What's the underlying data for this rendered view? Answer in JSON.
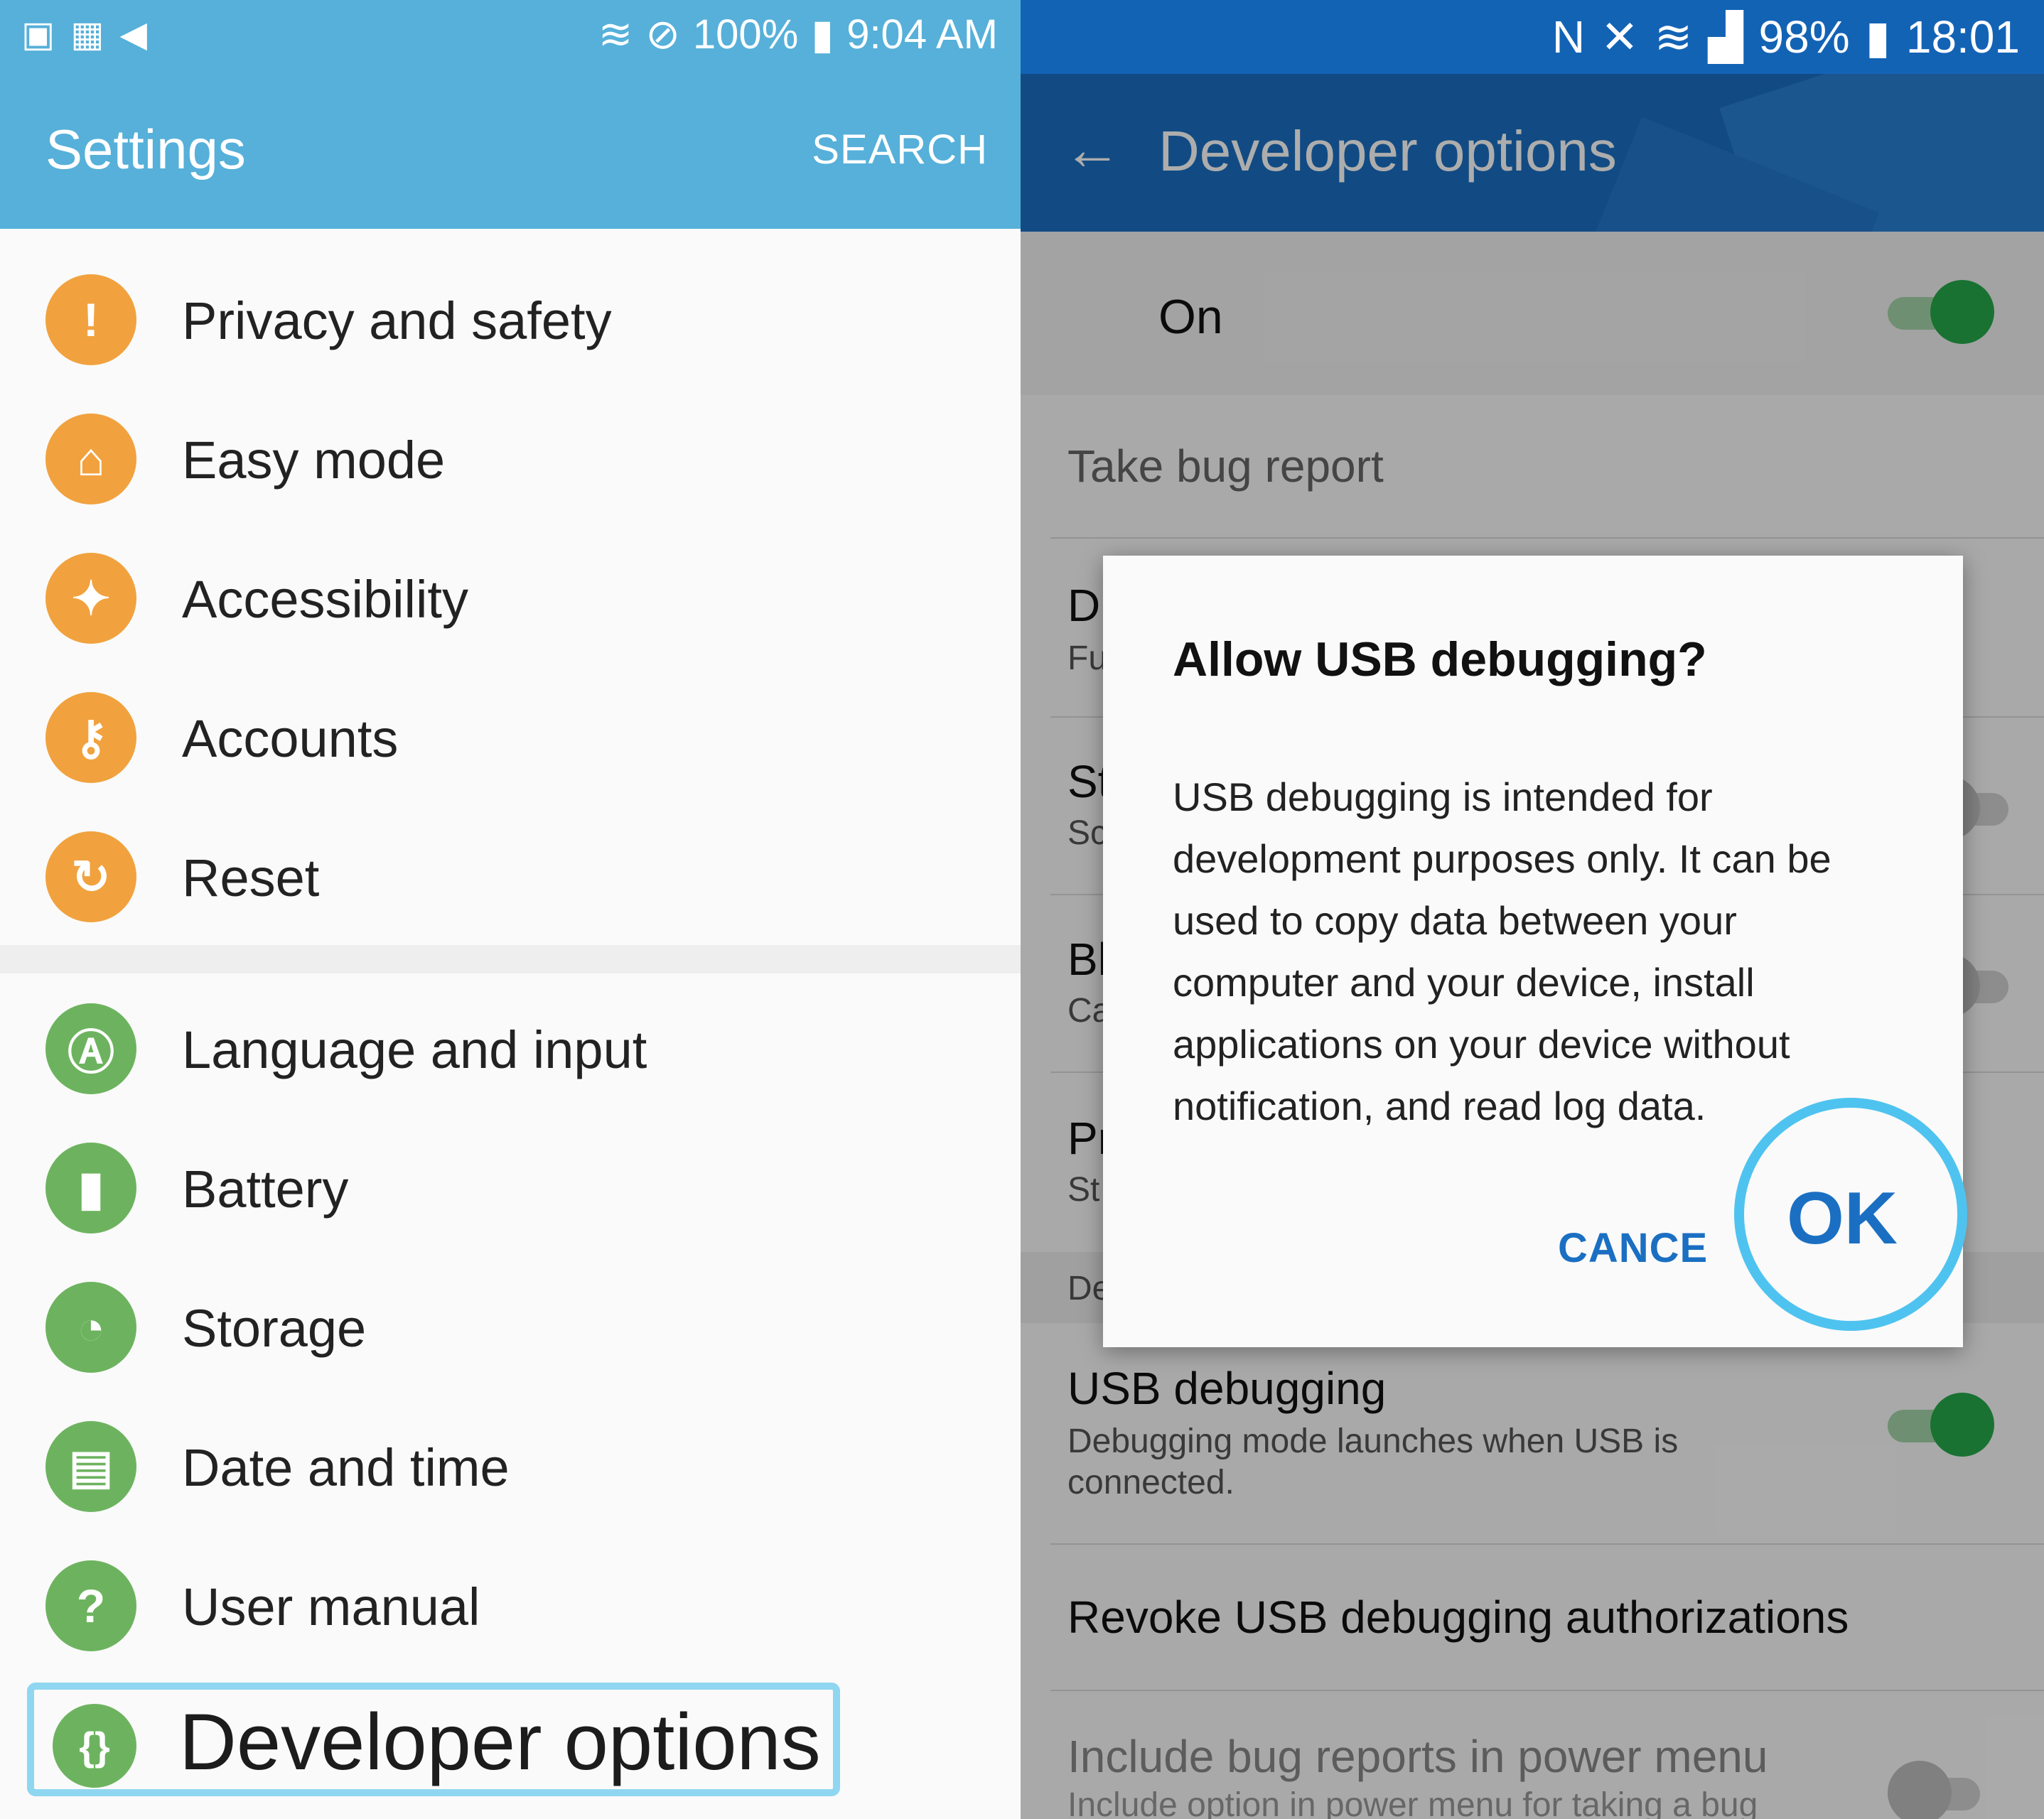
{
  "left": {
    "status": {
      "icons_left": [
        "image-icon",
        "calendar-icon",
        "telegram-icon"
      ],
      "battery": "100%",
      "time": "9:04 AM"
    },
    "title": "Settings",
    "search": "SEARCH",
    "items_group1": [
      {
        "label": "Privacy and safety",
        "icon": "privacy-icon",
        "color": "#f1a23e"
      },
      {
        "label": "Easy mode",
        "icon": "easy-mode-icon",
        "color": "#f1a23e"
      },
      {
        "label": "Accessibility",
        "icon": "accessibility-icon",
        "color": "#f1a23e"
      },
      {
        "label": "Accounts",
        "icon": "accounts-key-icon",
        "color": "#f1a23e"
      },
      {
        "label": "Reset",
        "icon": "reset-icon",
        "color": "#f1a23e"
      }
    ],
    "items_group2": [
      {
        "label": "Language and input",
        "icon": "language-icon",
        "color": "#6db35f"
      },
      {
        "label": "Battery",
        "icon": "battery-icon",
        "color": "#6db35f"
      },
      {
        "label": "Storage",
        "icon": "storage-icon",
        "color": "#6db35f"
      },
      {
        "label": "Date and time",
        "icon": "date-time-icon",
        "color": "#6db35f"
      },
      {
        "label": "User manual",
        "icon": "user-manual-icon",
        "color": "#6db35f"
      }
    ],
    "developer": {
      "label": "Developer options",
      "icon": "developer-braces-icon"
    }
  },
  "right": {
    "status": {
      "battery": "98%",
      "time": "18:01"
    },
    "title": "Developer options",
    "master": {
      "label": "On",
      "enabled": true
    },
    "rows": {
      "bug_report": "Take bug report",
      "row1_t": "D",
      "row1_s": "Fu",
      "row2_t": "St",
      "row2_s": "Sc",
      "row3_t": "Bl",
      "row3_s": "Ca",
      "row4_t": "Pr",
      "row4_s": "St",
      "section": "De",
      "usb_title": "USB debugging",
      "usb_sub": "Debugging mode launches when USB is connected.",
      "usb_enabled": true,
      "revoke": "Revoke USB debugging authorizations",
      "include_title": "Include bug reports in power menu",
      "include_sub": "Include option in power menu for taking a bug",
      "include_enabled": false
    },
    "dialog": {
      "title": "Allow USB debugging?",
      "body": "USB debugging is intended for development purposes only. It can be used to copy data between your computer and your device, install applications on your device without notification, and read log data.",
      "cancel": "CANCE",
      "ok": "OK"
    }
  },
  "colors": {
    "left_bar": "#56b0d9",
    "right_bar": "#1b6fc2",
    "highlight": "#4fc3ef",
    "toggle_on": "#25a94a"
  }
}
